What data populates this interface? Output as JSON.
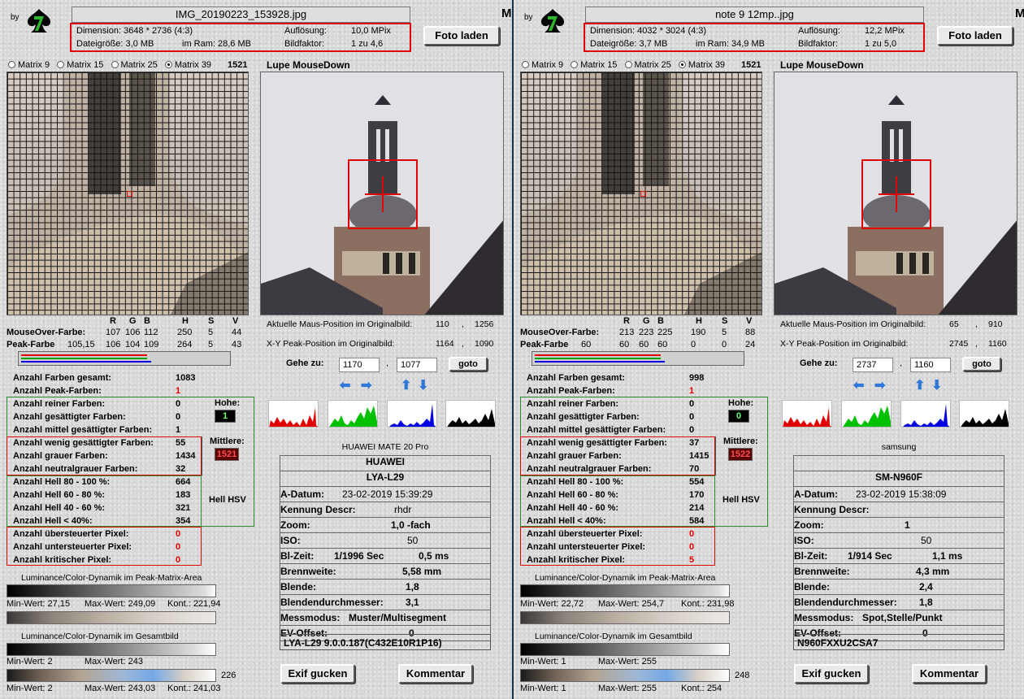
{
  "app": {
    "by_label": "by",
    "m_glyph": "M"
  },
  "common": {
    "foto_laden": "Foto laden",
    "matrix_options": [
      "Matrix 9",
      "Matrix 15",
      "Matrix 25",
      "Matrix 39"
    ],
    "lupe_title": "Lupe MouseDown",
    "rgb_headers": [
      "R",
      "G",
      "B",
      "H",
      "S",
      "V"
    ],
    "mouseover_label": "MouseOver-Farbe:",
    "peak_label": "Peak-Farbe",
    "maus_position_label": "Aktuelle Maus-Position  im Originalbild:",
    "peak_position_label": "X-Y Peak-Position  im Originalbild:",
    "gehe_zu_label": "Gehe zu:",
    "goto_label": "goto",
    "comma": ",",
    "stats_labels": [
      "Anzahl Farben gesamt:",
      "Anzahl Peak-Farben:",
      "Anzahl reiner Farben:",
      "Anzahl gesättigter Farben:",
      "Anzahl mittel gesättigter Farben:",
      "Anzahl wenig gesättigter Farben:",
      "Anzahl grauer Farben:",
      "Anzahl neutralgrauer Farben:",
      "Anzahl Hell 80 - 100 %:",
      "Anzahl Hell 60 - 80 %:",
      "Anzahl Hell 40 - 60 %:",
      "Anzahl Hell < 40%:",
      "Anzahl übersteuerter Pixel:",
      "Anzahl untersteuerter Pixel:",
      "Anzahl kritischer Pixel:"
    ],
    "hohe_label": "Hohe:",
    "mittlere_label": "Mittlere:",
    "hell_hsv_label": "Hell HSV",
    "lum_peak_title": "Luminance/Color-Dynamik im Peak-Matrix-Area",
    "lum_gesamt_title": "Luminance/Color-Dynamik im Gesamtbild",
    "min_wert_label": "Min-Wert:",
    "max_wert_label": "Max-Wert:",
    "kont_label": "Kont.:",
    "exif_labels": [
      "A-Datum:",
      "Kennung Descr:",
      "Zoom:",
      "ISO:",
      "Bl-Zeit:",
      "Brennweite:",
      "Blende:",
      "Blendendurchmesser:",
      "Messmodus:",
      "EV-Offset:"
    ],
    "exif_button": "Exif gucken",
    "kommentar_button": "Kommentar",
    "histogram_colors": [
      "#e00000",
      "#00c000",
      "#0000e0",
      "#000000"
    ]
  },
  "panels": [
    {
      "filename": "IMG_20190223_153928.jpg",
      "dimension": "Dimension: 3648 * 2736 (4:3)",
      "aufloesung_label": "Auflösung:",
      "aufloesung": "10,0 MPix",
      "dateigroesse": "Dateigröße: 3,0 MB",
      "im_ram": "im Ram: 28,6 MB",
      "bildfaktor_label": "Bildfaktor:",
      "bildfaktor": "1 zu 4,6",
      "selected_matrix": 3,
      "matrix_count": "1521",
      "mouseover": [
        "107",
        "106",
        "112",
        "250",
        "5",
        "44"
      ],
      "peak": [
        "105,15",
        "106",
        "104",
        "109",
        "264",
        "5",
        "43"
      ],
      "maus_pos": [
        "110",
        "1256"
      ],
      "peak_pos": [
        "1164",
        "1090"
      ],
      "goto_x": "1170",
      "goto_y": "1077",
      "stats": [
        "1083",
        "1",
        "0",
        "0",
        "1",
        "55",
        "1434",
        "32",
        "664",
        "183",
        "321",
        "354",
        "0",
        "0",
        "0"
      ],
      "hohe": "1",
      "mittlere": "1521",
      "lum_peak": {
        "min": "27,15",
        "max": "249,09",
        "kont": "221,94"
      },
      "lum_gesamt": {
        "min": "2",
        "max": "243",
        "side": "226",
        "min2": "2",
        "max2": "243,03",
        "kont2": "241,03"
      },
      "exif_header": "HUAWEI MATE 20 Pro",
      "make": "HUAWEI",
      "model": "LYA-L29",
      "a_datum": "23-02-2019 15:39:29",
      "kennung": "rhdr",
      "zoom": "1,0 -fach",
      "iso": "50",
      "bl_zeit": "1/1996 Sec",
      "bl_zeit2": "0,5 ms",
      "brennweite": "5,58  mm",
      "blende": "1,8",
      "blendendurchmesser": "3,1",
      "messmodus": "Muster/Multisegment",
      "ev_offset": "0",
      "firmware": "LYA-L29 9.0.0.187(C432E10R1P16)"
    },
    {
      "filename": "note 9 12mp..jpg",
      "dimension": "Dimension: 4032 * 3024 (4:3)",
      "aufloesung_label": "Auflösung:",
      "aufloesung": "12,2 MPix",
      "dateigroesse": "Dateigröße: 3,7 MB",
      "im_ram": "im Ram: 34,9 MB",
      "bildfaktor_label": "Bildfaktor:",
      "bildfaktor": "1 zu 5,0",
      "selected_matrix": 3,
      "matrix_count": "1521",
      "mouseover": [
        "213",
        "223",
        "225",
        "190",
        "5",
        "88"
      ],
      "peak": [
        "60",
        "60",
        "60",
        "60",
        "0",
        "0",
        "24"
      ],
      "maus_pos": [
        "65",
        "910"
      ],
      "peak_pos": [
        "2745",
        "1160"
      ],
      "goto_x": "2737",
      "goto_y": "1160",
      "stats": [
        "998",
        "1",
        "0",
        "0",
        "0",
        "37",
        "1415",
        "70",
        "554",
        "170",
        "214",
        "584",
        "0",
        "0",
        "5"
      ],
      "hohe": "0",
      "mittlere": "1522",
      "lum_peak": {
        "min": "22,72",
        "max": "254,7",
        "kont": "231,98"
      },
      "lum_gesamt": {
        "min": "1",
        "max": "255",
        "side": "248",
        "min2": "1",
        "max2": "255",
        "kont2": "254"
      },
      "exif_header": "samsung",
      "make": "",
      "model": "SM-N960F",
      "a_datum": "23-02-2019 15:38:09",
      "kennung": "",
      "zoom": "1",
      "iso": "50",
      "bl_zeit": "1/914 Sec",
      "bl_zeit2": "1,1 ms",
      "brennweite": "4,3    mm",
      "blende": "2,4",
      "blendendurchmesser": "1,8",
      "messmodus": "Spot,Stelle/Punkt",
      "ev_offset": "0",
      "firmware": "N960FXXU2CSA7"
    }
  ]
}
